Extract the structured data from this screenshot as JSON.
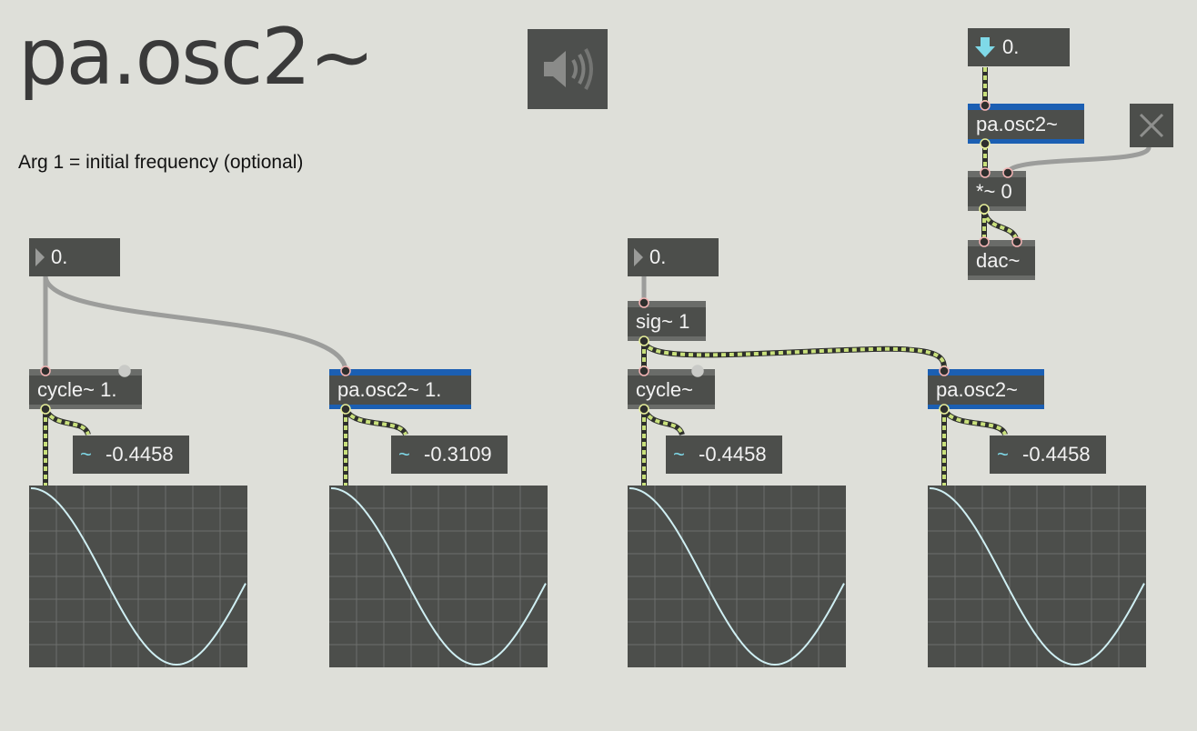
{
  "title": "pa.osc2~",
  "comment": "Arg 1 = initial frequency (optional)",
  "top_right": {
    "number_value": "0.",
    "osc_label": "pa.osc2~",
    "mult_label": "*~ 0",
    "dac_label": "dac~"
  },
  "left_number": "0.",
  "right_number": "0.",
  "sig_label": "sig~ 1",
  "objects": {
    "cycle1_label": "cycle~ 1.",
    "osc1_label": "pa.osc2~ 1.",
    "cycle2_label": "cycle~",
    "osc2_label": "pa.osc2~"
  },
  "signal_displays": [
    "-0.4458",
    "-0.3109",
    "-0.4458",
    "-0.4458"
  ],
  "wave_glyph": "~",
  "colors": {
    "background": "#dedfd9",
    "object": "#4c4e4b",
    "blue_object_bar": "#1b5fb3",
    "signal_cord": "#c9e07c",
    "scope_line": "#cfeff3",
    "signal_value_icon": "#7fd9e8"
  },
  "icons": [
    "speaker-icon",
    "close-icon",
    "down-arrow-icon",
    "play-triangle-icon",
    "wave-icon"
  ]
}
